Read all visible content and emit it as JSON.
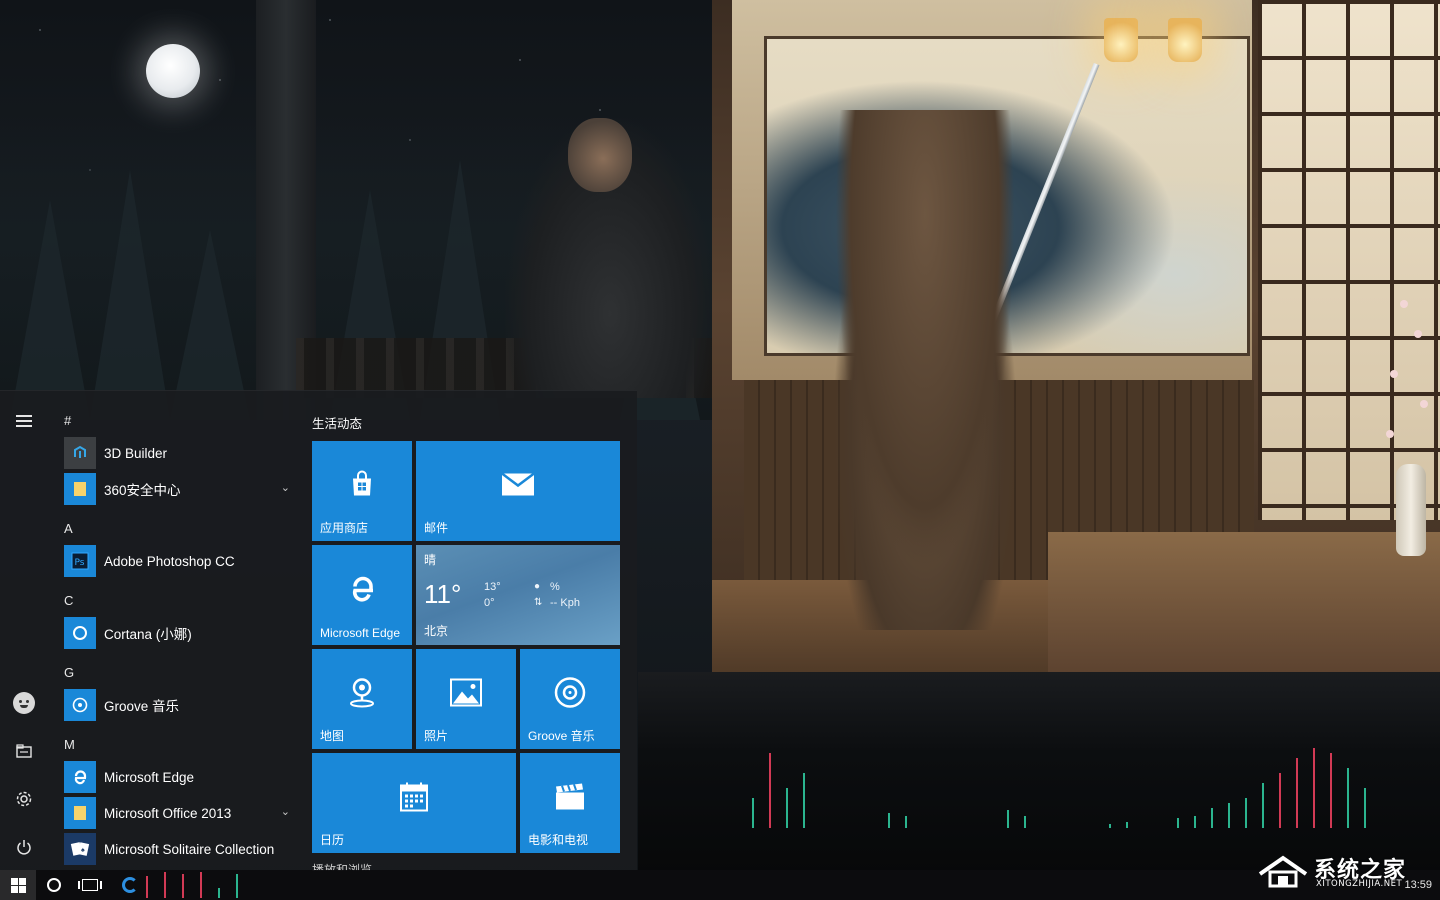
{
  "start_menu": {
    "rail": {
      "menu_icon": "hamburger-icon",
      "user_icon": "user-avatar-icon",
      "explorer_icon": "file-explorer-icon",
      "settings_icon": "gear-icon",
      "power_icon": "power-icon"
    },
    "app_list": {
      "sections": [
        {
          "letter": "#",
          "apps": [
            {
              "label": "3D Builder",
              "icon": "3d-builder-icon",
              "expandable": false
            },
            {
              "label": "360安全中心",
              "icon": "folder-icon",
              "expandable": true
            }
          ]
        },
        {
          "letter": "A",
          "apps": [
            {
              "label": "Adobe Photoshop CC",
              "icon": "photoshop-icon",
              "expandable": false
            }
          ]
        },
        {
          "letter": "C",
          "apps": [
            {
              "label": "Cortana (小娜)",
              "icon": "cortana-icon",
              "expandable": false
            }
          ]
        },
        {
          "letter": "G",
          "apps": [
            {
              "label": "Groove 音乐",
              "icon": "groove-music-icon",
              "expandable": false
            }
          ]
        },
        {
          "letter": "M",
          "apps": [
            {
              "label": "Microsoft Edge",
              "icon": "edge-icon",
              "expandable": false
            },
            {
              "label": "Microsoft Office 2013",
              "icon": "folder-icon",
              "expandable": true
            },
            {
              "label": "Microsoft Solitaire Collection",
              "icon": "solitaire-icon",
              "expandable": false
            }
          ]
        }
      ]
    },
    "tiles": {
      "group_title": "生活动态",
      "next_group_title": "播放和浏览",
      "items": [
        {
          "label": "应用商店",
          "icon": "store-icon"
        },
        {
          "label": "邮件",
          "icon": "mail-icon"
        },
        {
          "label": "Microsoft Edge",
          "icon": "edge-icon"
        },
        {
          "label": "地图",
          "icon": "maps-icon"
        },
        {
          "label": "照片",
          "icon": "photos-icon"
        },
        {
          "label": "Groove 音乐",
          "icon": "groove-music-icon"
        },
        {
          "label": "日历",
          "icon": "calendar-icon"
        },
        {
          "label": "电影和电视",
          "icon": "movies-tv-icon"
        }
      ],
      "weather": {
        "condition": "晴",
        "temp": "11°",
        "high": "13°",
        "low": "0°",
        "humidity": "%",
        "wind": "-- Kph",
        "city": "北京"
      }
    }
  },
  "taskbar": {
    "start_icon": "windows-logo-icon",
    "search_icon": "cortana-circle-icon",
    "task_view_icon": "task-view-icon",
    "pinned_icon": "edge-icon",
    "clock": "13:59"
  },
  "watermark": {
    "title": "系统之家",
    "url": "XITONGZHIJIA.NET"
  },
  "colors": {
    "tile_accent": "#1a88d8",
    "start_bg": "#1a1c1f",
    "viz_red": "#d23a55",
    "viz_green": "#2bb58f"
  }
}
